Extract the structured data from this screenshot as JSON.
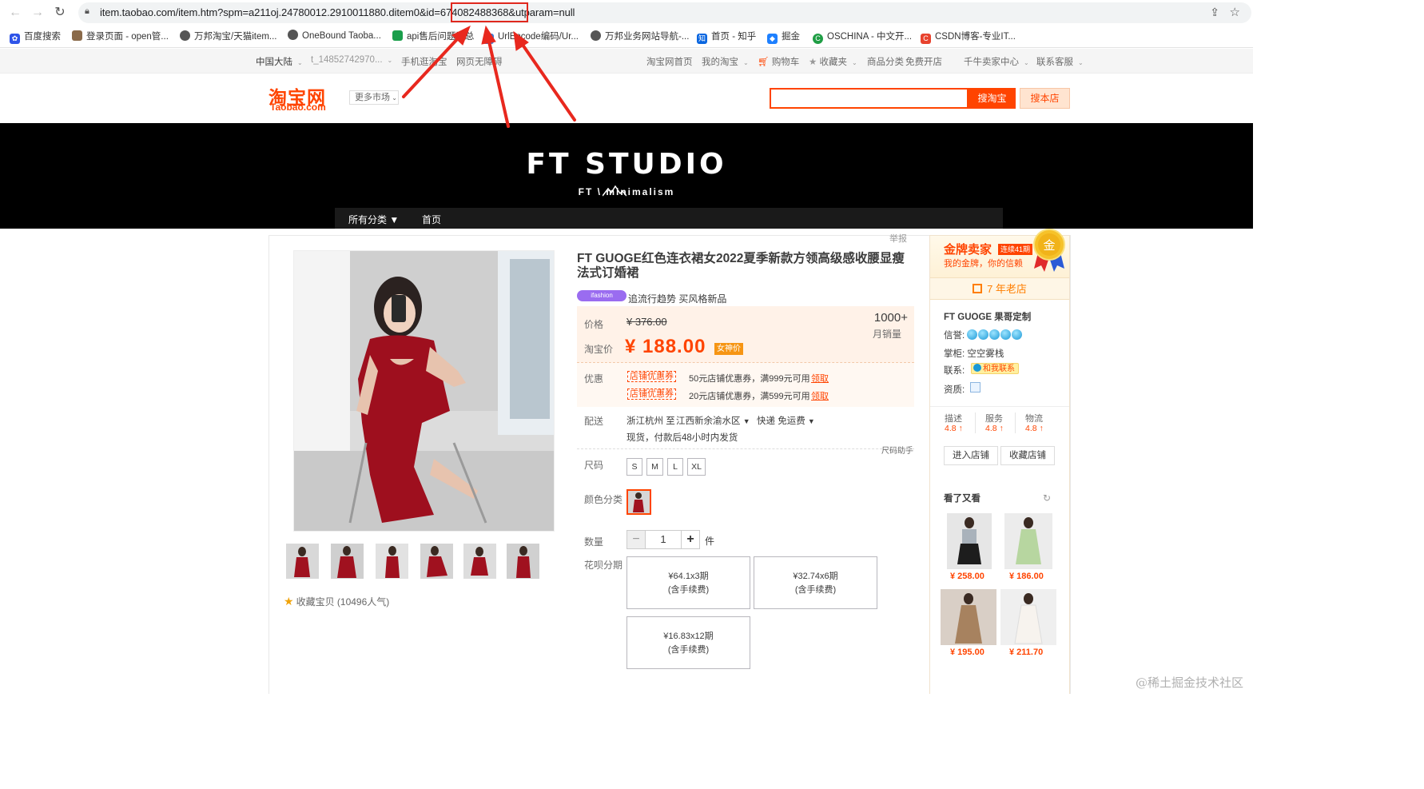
{
  "browser": {
    "url_prefix": "item.taobao.com/item.htm?spm=a211oj.24780012.2910011880.ditem0&id",
    "url_id": "=674082488368",
    "url_suffix": "&utparam=null",
    "bookmarks": [
      "百度搜索",
      "登录页面 - open管...",
      "万邦淘宝/天猫item...",
      "OneBound Taoba...",
      "api售后问题汇总",
      "UrlEncode编码/Ur...",
      "万邦业务网站导航-...",
      "首页 - 知乎",
      "掘金",
      "OSCHINA - 中文开...",
      "CSDN博客-专业IT..."
    ]
  },
  "topnav": {
    "region": "中国大陆",
    "user": "t_14852742970...",
    "mobile": "手机逛淘宝",
    "accessible": "网页无障碍",
    "home": "淘宝网首页",
    "my": "我的淘宝",
    "cart": "购物车",
    "fav": "收藏夹",
    "category": "商品分类",
    "open_shop": "免费开店",
    "seller": "千牛卖家中心",
    "service": "联系客服"
  },
  "header": {
    "logo_cn": "淘宝网",
    "logo_en": "Taobao.com",
    "more_market": "更多市场",
    "search_btn": "搜淘宝",
    "search_shop": "搜本店"
  },
  "banner": {
    "title": "FT  STUDIO",
    "subtitle": "FT \\ minimalism",
    "nav_all": "所有分类 ▼",
    "nav_home": "首页"
  },
  "product": {
    "report": "举报",
    "title": "FT GUOGE红色连衣裙女2022夏季新款方领高级感收腰显瘦法式订婚裙",
    "ifashion": "ifashion",
    "trend": "追流行趋势 买风格新品",
    "price_label": "价格",
    "old_price": "¥ 376.00",
    "tb_price_label": "淘宝价",
    "price": "¥ 188.00",
    "deal_tag": "女神价",
    "sales_num": "1000+",
    "sales_label": "月销量",
    "promo_label": "优惠",
    "coupons": [
      {
        "tag": "店铺优惠券",
        "text": "50元店铺优惠券，满999元可用",
        "get": "领取"
      },
      {
        "tag": "店铺优惠券",
        "text": "20元店铺优惠券，满599元可用",
        "get": "领取"
      }
    ],
    "ship_label": "配送",
    "ship_from": "浙江杭州 至",
    "ship_to": "江西新余渝水区",
    "ship_method": "快递 免运费",
    "ship_note": "现货，付款后48小时内发货",
    "size_helper": "尺码助手",
    "size_label": "尺码",
    "sizes": [
      "S",
      "M",
      "L",
      "XL"
    ],
    "color_label": "颜色分类",
    "qty_label": "数量",
    "qty_value": "1",
    "qty_unit": "件",
    "installment_label": "花呗分期",
    "installments": [
      {
        "amount": "¥64.1x3期",
        "fee": "(含手续费)"
      },
      {
        "amount": "¥32.74x6期",
        "fee": "(含手续费)"
      },
      {
        "amount": "¥16.83x12期",
        "fee": "(含手续费)"
      }
    ],
    "fav_text": "收藏宝贝 (10496人气)"
  },
  "seller": {
    "gold_title": "金牌卖家",
    "gold_years": "连续41期",
    "gold_slogan": "我的金牌，你的信赖",
    "medal_text": "金",
    "old_store": "7 年老店",
    "store_name": "FT GUOGE 果哥定制",
    "credit_label": "信誉:",
    "keeper_label": "掌柜:",
    "keeper": "空空雾栈",
    "contact_label": "联系:",
    "contact_badge": "和我联系",
    "qual_label": "资质:",
    "scores": [
      {
        "label": "描述",
        "value": "4.8 ↑"
      },
      {
        "label": "服务",
        "value": "4.8 ↑"
      },
      {
        "label": "物流",
        "value": "4.8 ↑"
      }
    ],
    "enter_store": "进入店铺",
    "fav_store": "收藏店铺",
    "also_title": "看了又看",
    "recs": [
      "¥ 258.00",
      "¥ 186.00",
      "¥ 195.00",
      "¥ 211.70"
    ]
  },
  "watermark": "@稀土掘金技术社区",
  "colors": {
    "accent": "#ff4400",
    "highlight": "#e0281e"
  }
}
